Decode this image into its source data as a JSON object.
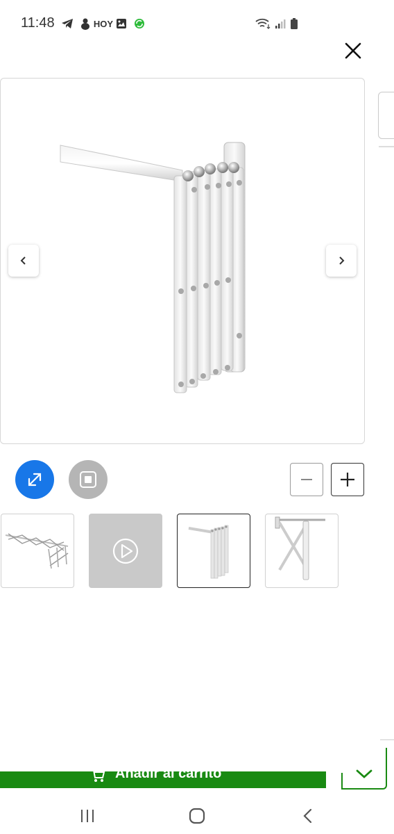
{
  "status_bar": {
    "time": "11:48",
    "hoy_label": "HOY",
    "left_icons": [
      "telegram-icon",
      "snow-icon",
      "hoy-icon",
      "gallery-icon",
      "sync-icon"
    ],
    "right_icons": [
      "wifi-icon",
      "signal-icon",
      "battery-icon"
    ]
  },
  "viewer": {
    "close_icon": "close-icon",
    "prev_icon": "chevron-left-icon",
    "next_icon": "chevron-right-icon",
    "main_image": "folding-wall-drying-rack-image"
  },
  "controls": {
    "fullscreen_icon": "expand-icon",
    "stop_icon": "stop-icon",
    "zoom_out_icon": "minus-icon",
    "zoom_in_icon": "plus-icon",
    "accent_color": "#1877e8"
  },
  "thumbnails": [
    {
      "name": "thumbnail-extended-rack",
      "type": "image",
      "active": false
    },
    {
      "name": "thumbnail-video",
      "type": "video",
      "active": false
    },
    {
      "name": "thumbnail-folded-rack",
      "type": "image",
      "active": true
    },
    {
      "name": "thumbnail-side-view",
      "type": "image",
      "active": false
    }
  ],
  "bottom_bar": {
    "cart_label": "Añadir al carrito",
    "cart_color": "#198a12",
    "quantity_chevron_icon": "chevron-down-icon"
  },
  "system_nav": {
    "recents_icon": "recents-icon",
    "home_icon": "home-icon",
    "back_icon": "back-icon"
  }
}
